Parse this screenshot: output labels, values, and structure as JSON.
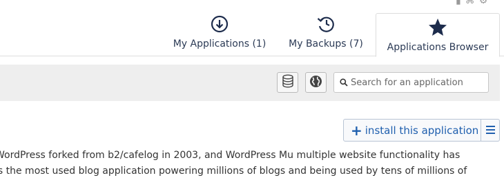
{
  "header_icons": [
    "tool-icon",
    "sitemap-icon",
    "gear-icon"
  ],
  "tabs": [
    {
      "label": "My Applications (1)",
      "icon": "download-circle-icon"
    },
    {
      "label": "My Backups (7)",
      "icon": "history-icon"
    },
    {
      "label": "Applications Browser",
      "icon": "star-icon",
      "active": true
    }
  ],
  "toolbar": {
    "search_placeholder": "Search for an application"
  },
  "app": {
    "install_label": "install this application",
    "description_lines": [
      "WordPress forked from b2/cafelog in 2003, and WordPress Mu multiple website functionality has",
      "is the most used blog application powering millions of blogs and being used by tens of millions of"
    ]
  },
  "colors": {
    "accent": "#1f5fae",
    "icon_dark": "#1d2c4c",
    "toolbar_bg": "#eeeeee"
  }
}
